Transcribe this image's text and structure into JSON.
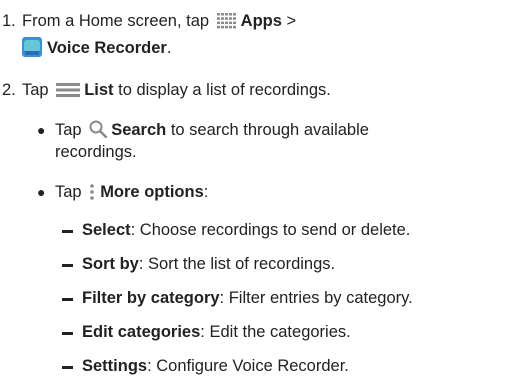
{
  "steps": [
    {
      "number": "1.",
      "prefix": "From a Home screen, tap ",
      "apps_icon": "apps-grid-icon",
      "apps_label": "Apps",
      "separator": " >",
      "recorder_icon": "voice-recorder-app-icon",
      "recorder_label": "Voice Recorder",
      "suffix": "."
    },
    {
      "number": "2.",
      "prefix": "Tap ",
      "list_icon": "list-icon",
      "list_label": "List",
      "suffix": " to display a list of recordings."
    }
  ],
  "bullets": [
    {
      "prefix": "Tap ",
      "icon": "search-icon",
      "label": "Search",
      "text_line1": " to search through available",
      "text_line2": "recordings."
    },
    {
      "prefix": "Tap ",
      "icon": "more-options-icon",
      "label": "More options",
      "suffix": ":"
    }
  ],
  "sub_items": [
    {
      "term": "Select",
      "desc": ": Choose recordings to send or delete."
    },
    {
      "term": "Sort by",
      "desc": ": Sort the list of recordings."
    },
    {
      "term": "Filter by category",
      "desc": ": Filter entries by category."
    },
    {
      "term": "Edit categories",
      "desc": ": Edit the categories."
    },
    {
      "term": "Settings",
      "desc": ": Configure Voice Recorder."
    }
  ],
  "colors": {
    "text": "#222222",
    "icon_gray": "#8a8a8a",
    "recorder_blue": "#3a8fd8",
    "recorder_teal": "#66c7d6"
  }
}
